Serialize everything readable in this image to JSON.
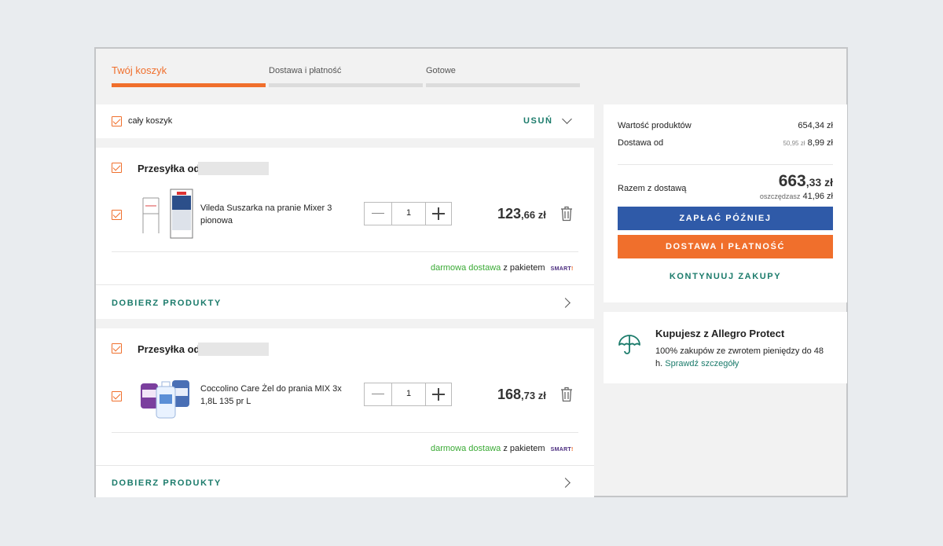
{
  "steps": [
    {
      "label": "Twój koszyk",
      "active": true
    },
    {
      "label": "Dostawa i płatność",
      "active": false
    },
    {
      "label": "Gotowe",
      "active": false
    }
  ],
  "cart_header": {
    "select_all_label": "cały koszyk",
    "remove_label": "USUŃ"
  },
  "shipments": [
    {
      "title": "Przesyłka od",
      "product": {
        "name": "Vileda Suszarka na pranie Mixer 3 pionowa",
        "quantity": "1",
        "price_main": "123",
        "price_cents": ",66 zł"
      },
      "delivery": {
        "free": "darmowa dostawa",
        "suffix": "z pakietem",
        "badge": "SMART",
        "badge_suffix": "!"
      },
      "more_label": "DOBIERZ PRODUKTY"
    },
    {
      "title": "Przesyłka od",
      "product": {
        "name": "Coccolino Care Żel do prania MIX 3x 1,8L 135 pr L",
        "quantity": "1",
        "price_main": "168",
        "price_cents": ",73 zł"
      },
      "delivery": {
        "free": "darmowa dostawa",
        "suffix": "z pakietem",
        "badge": "SMART",
        "badge_suffix": "!"
      },
      "more_label": "DOBIERZ PRODUKTY"
    }
  ],
  "summary": {
    "products_label": "Wartość produktów",
    "products_value": "654,34 zł",
    "delivery_label": "Dostawa od",
    "delivery_old": "50,95 zł",
    "delivery_value": "8,99 zł",
    "total_label": "Razem z dostawą",
    "total_main": "663",
    "total_cents": ",33 zł",
    "savings_label": "oszczędzasz",
    "savings_value": "41,96 zł",
    "pay_later_label": "ZAPŁAĆ PÓŹNIEJ",
    "checkout_label": "DOSTAWA I PŁATNOŚĆ",
    "continue_label": "KONTYNUUJ ZAKUPY"
  },
  "protect": {
    "title": "Kupujesz z Allegro Protect",
    "text": "100% zakupów ze zwrotem pieniędzy do 48 h.",
    "link": "Sprawdź szczegóły"
  },
  "colors": {
    "accent": "#f06f2c",
    "teal": "#1b7b6b",
    "blue": "#2f5aa8",
    "green": "#3aaa35"
  }
}
